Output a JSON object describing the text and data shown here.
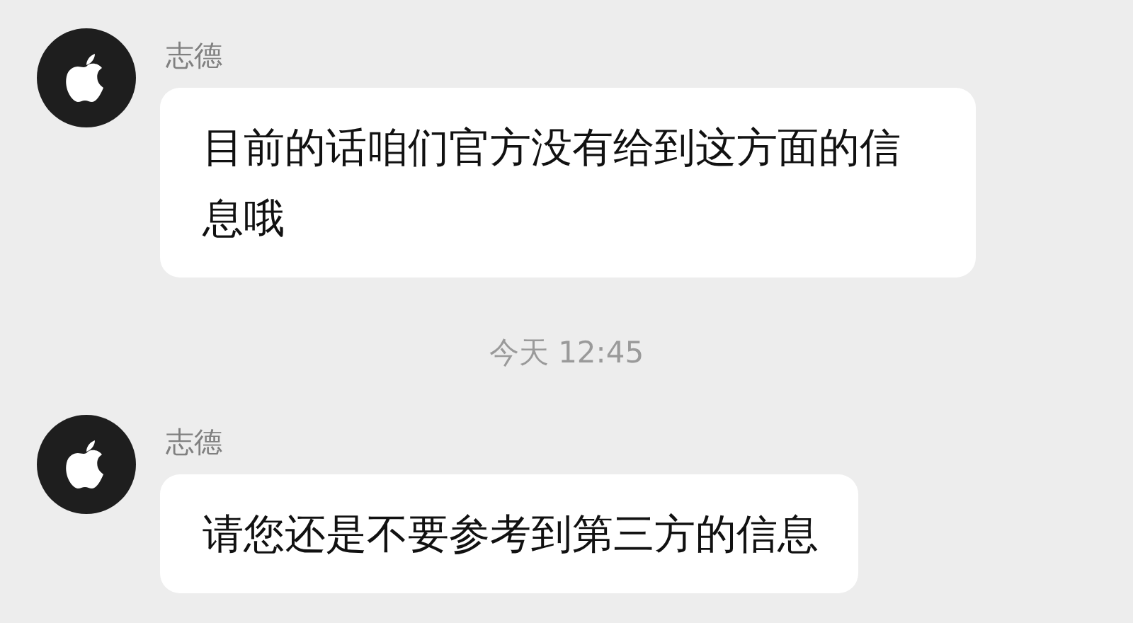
{
  "messages": [
    {
      "kind": "message",
      "sender": "志德",
      "text": "目前的话咱们官方没有给到这方面的信息哦"
    },
    {
      "kind": "timestamp",
      "text": "今天 12:45"
    },
    {
      "kind": "message",
      "sender": "志德",
      "text": "请您还是不要参考到第三方的信息"
    }
  ]
}
